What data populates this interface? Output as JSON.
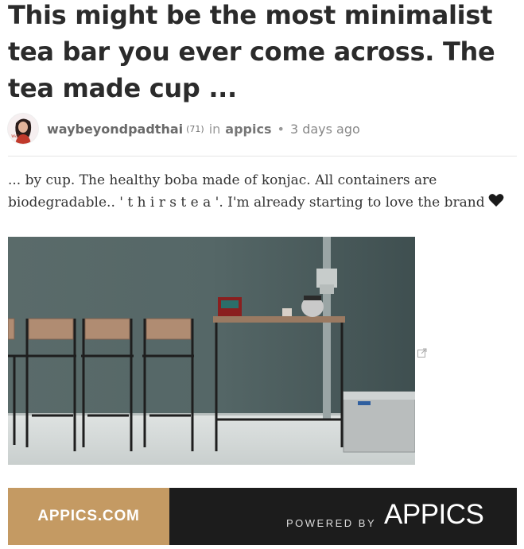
{
  "post": {
    "title": "This might be the most minimalist tea bar you ever come across. The tea made cup ...",
    "author": "waybeyondpadthai",
    "reputation": "(71)",
    "in_label": "in",
    "community": "appics",
    "dot": "•",
    "time": "3 days ago",
    "body": "... by cup. The healthy boba made of konjac. All containers are biodegradable.. ' t h i r s t e a '. I'm already starting to love the brand"
  },
  "icons": {
    "heart": "black-heart-icon",
    "external_link": "external-link-icon"
  },
  "banner": {
    "left_text": "APPICS.COM",
    "powered_by": "POWERED BY",
    "brand_text": "APPICS",
    "left_color": "#c49a63",
    "right_color": "#1c1c1c"
  }
}
